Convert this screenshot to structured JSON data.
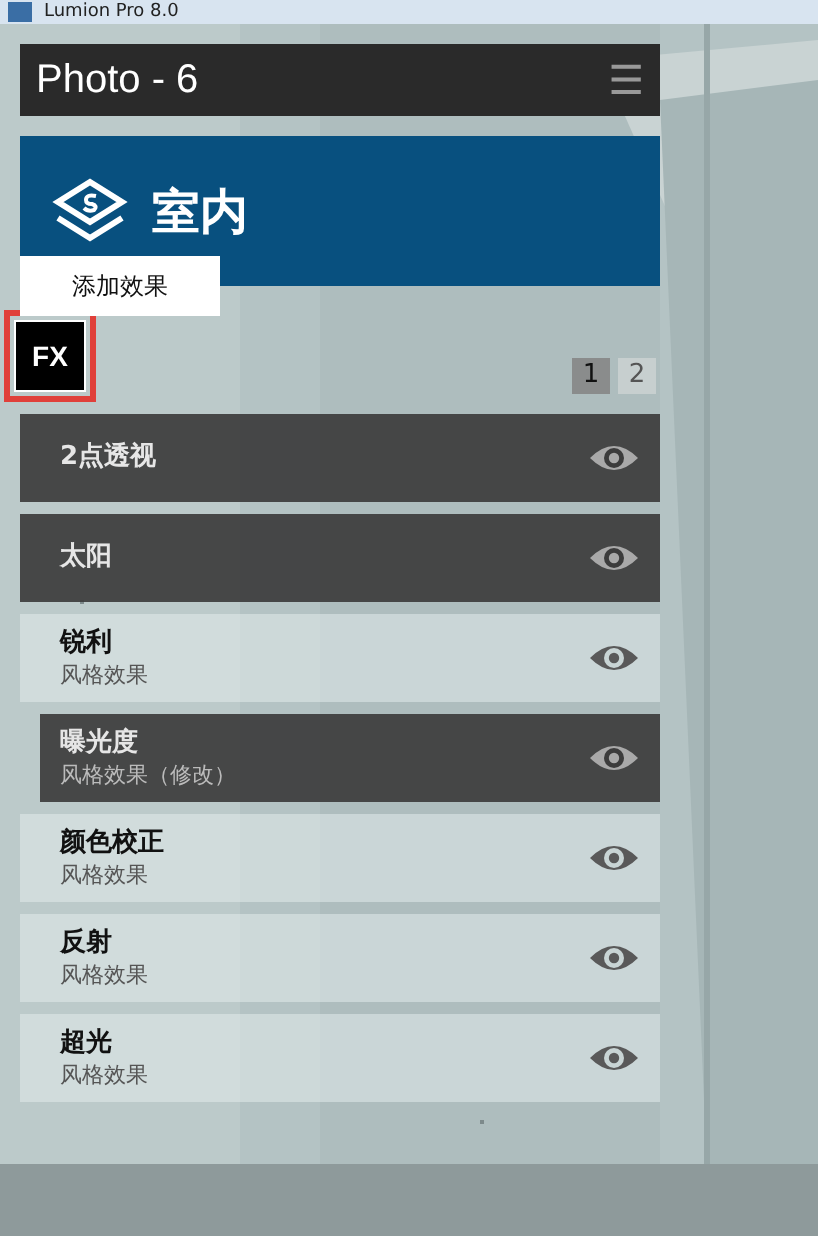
{
  "window": {
    "title": "Lumion Pro 8.0"
  },
  "header": {
    "title": "Photo - 6",
    "menu_glyph": "☰"
  },
  "category": {
    "title": "室内"
  },
  "tooltip": {
    "text": "添加效果"
  },
  "fx_button": {
    "label": "FX",
    "highlighted": true
  },
  "pages": [
    {
      "label": "1",
      "selected": true
    },
    {
      "label": "2",
      "selected": false
    }
  ],
  "effects": [
    {
      "kind": "base",
      "name": "2点透视",
      "selected": false
    },
    {
      "kind": "base",
      "name": "太阳",
      "selected": false
    },
    {
      "kind": "style",
      "name": "锐利",
      "subtitle": "风格效果",
      "selected": false
    },
    {
      "kind": "style",
      "name": "曝光度",
      "subtitle": "风格效果（修改）",
      "selected": true
    },
    {
      "kind": "style",
      "name": "颜色校正",
      "subtitle": "风格效果",
      "selected": false
    },
    {
      "kind": "style",
      "name": "反射",
      "subtitle": "风格效果",
      "selected": false
    },
    {
      "kind": "style",
      "name": "超光",
      "subtitle": "风格效果",
      "selected": false
    }
  ]
}
